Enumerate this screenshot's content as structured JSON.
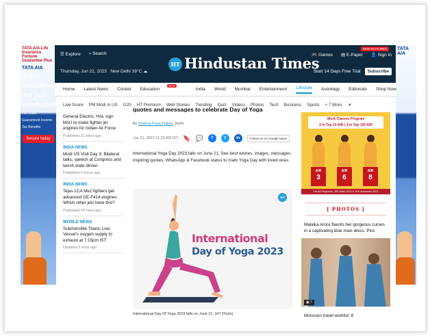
{
  "left_ad": {
    "brand": "TATA AIA",
    "product": "TATA AIA Life Insurance Fortune Guarantee Plus",
    "headline_lines": [
      "great",
      "investments,",
      "not just",
      "wardrobes"
    ],
    "features": [
      "Life cover",
      "Guaranteed Income",
      "Tax Benefits"
    ],
    "cta": "Secure today"
  },
  "header": {
    "explore": "Explore",
    "search": "Search",
    "logo_mark": "HT",
    "logo_text": "Hindustan Times",
    "games": "Games",
    "epaper": "E-Paper",
    "signin": "Sign In",
    "epaper_badge": "NEW FEATURES",
    "date": "Thursday, Jun 22, 2023",
    "weather": "New Delhi 39°C",
    "trial": "Start 14 Days Free Trial",
    "subscribe": "Subscribe"
  },
  "nav": {
    "items": [
      "Home",
      "Latest News",
      "Cricket",
      "Education",
      "India",
      "World",
      "Mumbai",
      "Entertainment",
      "Lifestyle",
      "Astrology",
      "Editorials",
      "Shop Now"
    ],
    "active_index": 8,
    "education_badge": "NEW"
  },
  "subnav": {
    "items": [
      "Live Score",
      "PM Modi in US",
      "G20",
      "HT Premium",
      "Web Stories",
      "Trending",
      "Quiz",
      "Videos",
      "Photos",
      "Tech",
      "Business",
      "Sports",
      "+ 7 More"
    ]
  },
  "sidebar": {
    "items": [
      {
        "category": "",
        "title": "General Electric, HAL sign MoU to make fighter jet engines for Indian Air Force",
        "time": "Published 31 mins ago"
      },
      {
        "category": "INDIA NEWS",
        "title": "Modi US Visit Day 3: Bilateral talks, speech at Congress and lavish state dinner",
        "time": "Published 2 hours ago"
      },
      {
        "category": "INDIA NEWS",
        "title": "Tejas LCA Mk2 fighters get advanced GE-F414 engines. Which other jets have this?",
        "time": "Published 29 mins ago"
      },
      {
        "category": "WORLD NEWS",
        "title": "Submersible Titanic Live: Vessel's oxygen supply to exhaust at 7:15pm IST",
        "time": "Updated 3 mins ago"
      }
    ]
  },
  "article": {
    "headline": "quotes and messages to celebrate Day of Yoga",
    "byline_prefix": "By",
    "author": "Krishna Priya Pallavi",
    "location": ", Delhi",
    "timestamp": "Jun 21, 2023 11:33 AM IST",
    "share_icons": [
      "bookmark-icon",
      "comment-icon",
      "facebook-icon",
      "twitter-icon",
      "linkedin-icon"
    ],
    "follow_label": "Follow Us on Google News",
    "summary": "International Yoga Day 2023 falls on June 21. See best wishes, images, messages, inspiring quotes, WhatsApp & Facebook status to mark Yoga Day with loved ones.",
    "hero_line1": "International",
    "hero_line2": "Day of Yoga 2023",
    "hero_badge": "HT",
    "caption": "International Day Of Yoga 2023 falls on June 21. (HT Photo)"
  },
  "promo": {
    "top_line1": "Work Classes Program",
    "top_line2": "3 in Top 10 AIR  |  3 in Top 100 AIR",
    "ranks": [
      "3",
      "6",
      "8"
    ],
    "rank_prefix": "AIR",
    "bottom": "For All Programs, JEE Main 2023 & JEE Advanced 2023"
  },
  "photos": {
    "title": "PHOTOS",
    "caption": "Malaika Arora flaunts her gorgeous curves in a captivating blue maxi dress. Pics",
    "count": "7",
    "next": "Monsoon travel wishlist: 8"
  },
  "colors": {
    "header_bg": "#0f2a3f",
    "accent": "#1590c7",
    "red": "#e41e26",
    "hero_pink": "#cf3c7a",
    "hero_blue": "#2e5d91",
    "promo_yellow": "#f6c940"
  }
}
